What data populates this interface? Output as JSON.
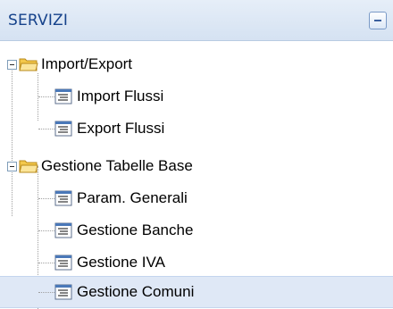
{
  "panel": {
    "title": "SERVIZI"
  },
  "tree": [
    {
      "label": "Import/Export",
      "expanded": true,
      "icon": "folder-open-icon",
      "children": [
        {
          "label": "Import Flussi",
          "icon": "document-icon",
          "selected": false
        },
        {
          "label": "Export Flussi",
          "icon": "document-icon",
          "selected": false
        }
      ]
    },
    {
      "label": "Gestione Tabelle Base",
      "expanded": true,
      "icon": "folder-open-icon",
      "children": [
        {
          "label": "Param. Generali",
          "icon": "document-icon",
          "selected": false
        },
        {
          "label": "Gestione Banche",
          "icon": "document-icon",
          "selected": false
        },
        {
          "label": "Gestione IVA",
          "icon": "document-icon",
          "selected": false
        },
        {
          "label": "Gestione Comuni",
          "icon": "document-icon",
          "selected": true
        }
      ]
    }
  ],
  "colors": {
    "header_text": "#15428b",
    "selection": "#dfe8f6",
    "folder": "#f7d774"
  }
}
